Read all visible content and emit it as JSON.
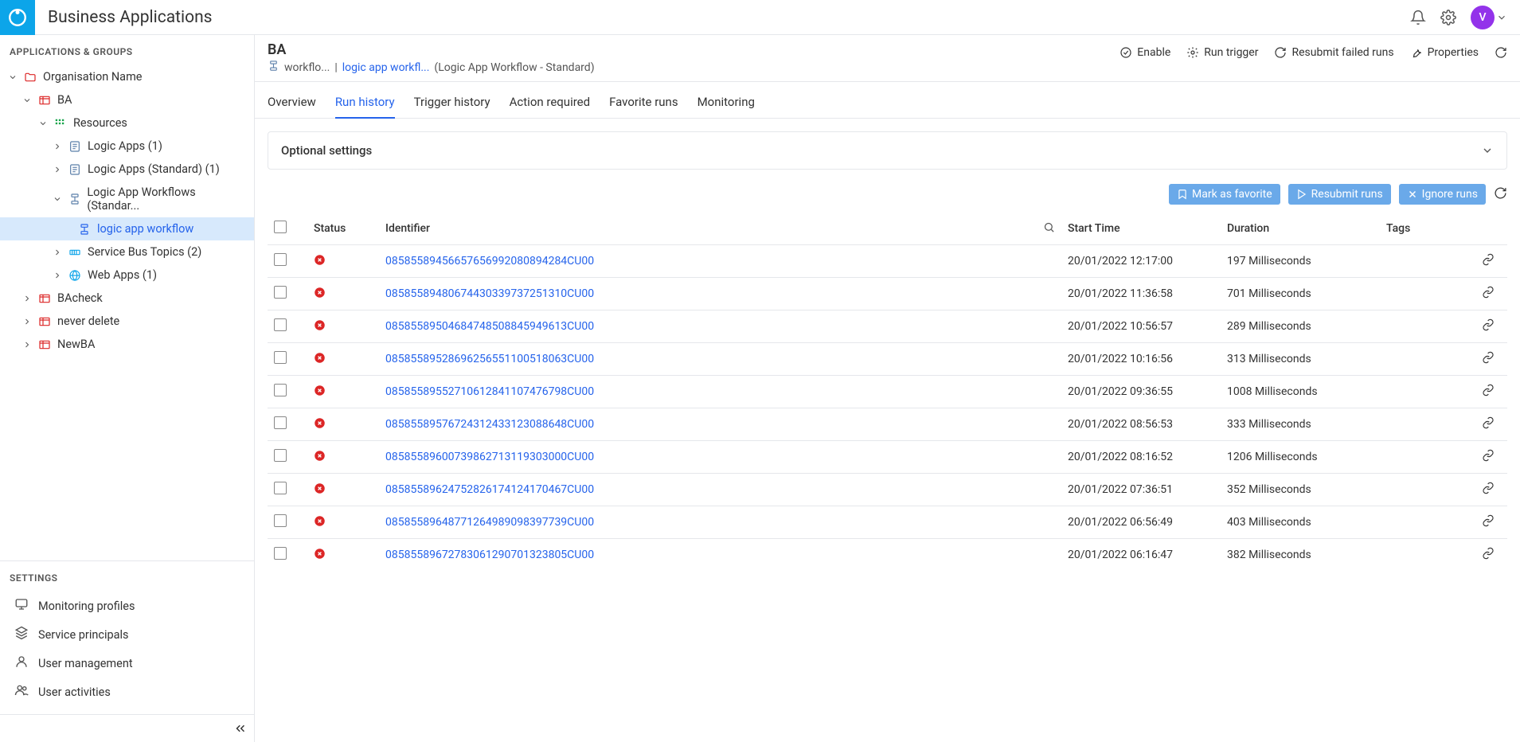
{
  "header": {
    "app_title": "Business Applications",
    "avatar_initial": "V"
  },
  "sidebar": {
    "section_title": "APPLICATIONS & GROUPS",
    "tree": {
      "org": "Organisation Name",
      "ba": "BA",
      "resources": "Resources",
      "la1": "Logic Apps (1)",
      "la_std": "Logic Apps (Standard) (1)",
      "la_wf": "Logic App Workflows (Standar...",
      "la_wf_item": "logic app workflow",
      "sb": "Service Bus Topics (2)",
      "web": "Web Apps (1)",
      "bacheck": "BAcheck",
      "never": "never delete",
      "newba": "NewBA"
    },
    "settings_title": "SETTINGS",
    "settings": {
      "monitoring": "Monitoring profiles",
      "principals": "Service principals",
      "users": "User management",
      "activities": "User activities"
    }
  },
  "page": {
    "title": "BA",
    "bc_workflo": "workflo...",
    "bc_sep": "|",
    "bc_link": "logic app workfl...",
    "bc_type": "(Logic App Workflow - Standard)",
    "actions": {
      "enable": "Enable",
      "run_trigger": "Run trigger",
      "resubmit_failed": "Resubmit failed runs",
      "properties": "Properties"
    },
    "tabs": {
      "overview": "Overview",
      "run_history": "Run history",
      "trigger_history": "Trigger history",
      "action_required": "Action required",
      "favorite": "Favorite runs",
      "monitoring": "Monitoring"
    },
    "optional_settings": "Optional settings",
    "buttons": {
      "mark_fav": "Mark as favorite",
      "resubmit": "Resubmit runs",
      "ignore": "Ignore runs"
    },
    "columns": {
      "status": "Status",
      "identifier": "Identifier",
      "start_time": "Start Time",
      "duration": "Duration",
      "tags": "Tags"
    },
    "rows": [
      {
        "id": "08585589456657656992080894284CU00",
        "start": "20/01/2022 12:17:00",
        "dur": "197 Milliseconds"
      },
      {
        "id": "08585589480674430339737251310CU00",
        "start": "20/01/2022 11:36:58",
        "dur": "701 Milliseconds"
      },
      {
        "id": "08585589504684748508845949613CU00",
        "start": "20/01/2022 10:56:57",
        "dur": "289 Milliseconds"
      },
      {
        "id": "08585589528696256551100518063CU00",
        "start": "20/01/2022 10:16:56",
        "dur": "313 Milliseconds"
      },
      {
        "id": "08585589552710612841107476798CU00",
        "start": "20/01/2022 09:36:55",
        "dur": "1008 Milliseconds"
      },
      {
        "id": "08585589576724312433123088648CU00",
        "start": "20/01/2022 08:56:53",
        "dur": "333 Milliseconds"
      },
      {
        "id": "08585589600739862713119303000CU00",
        "start": "20/01/2022 08:16:52",
        "dur": "1206 Milliseconds"
      },
      {
        "id": "08585589624752826174124170467CU00",
        "start": "20/01/2022 07:36:51",
        "dur": "352 Milliseconds"
      },
      {
        "id": "08585589648771264989098397739CU00",
        "start": "20/01/2022 06:56:49",
        "dur": "403 Milliseconds"
      },
      {
        "id": "08585589672783061290701323805CU00",
        "start": "20/01/2022 06:16:47",
        "dur": "382 Milliseconds"
      }
    ]
  }
}
